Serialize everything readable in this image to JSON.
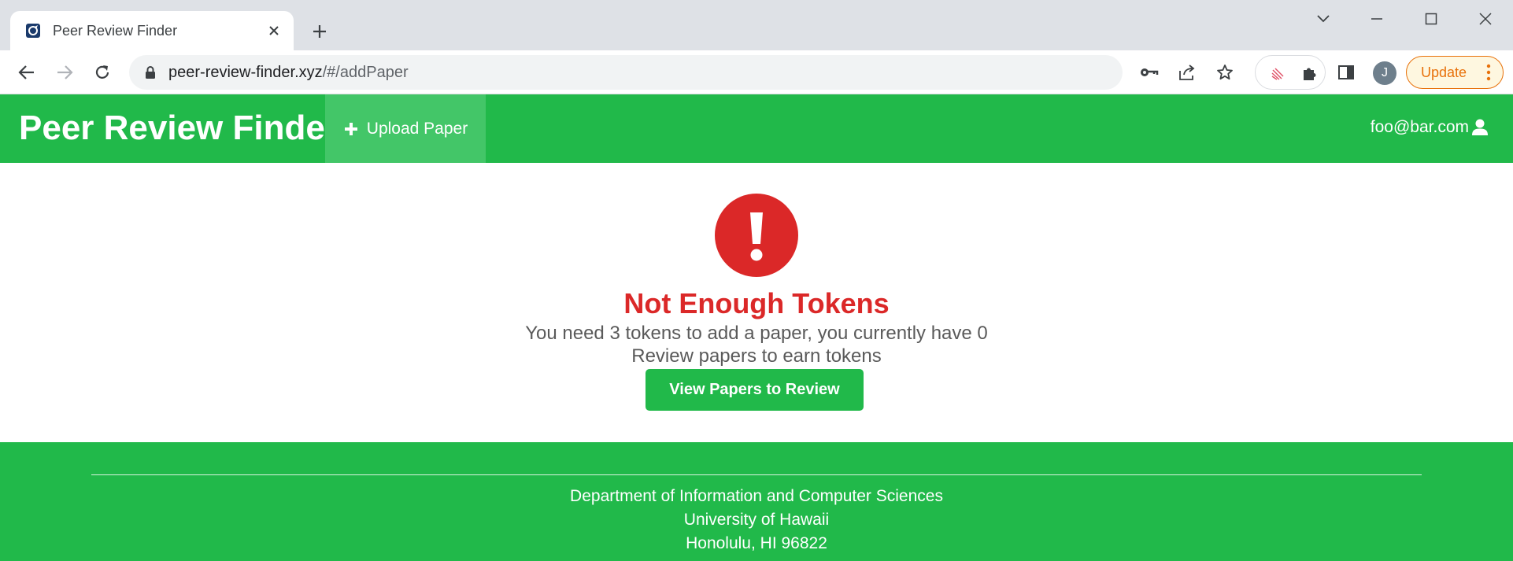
{
  "browser": {
    "tab_title": "Peer Review Finder",
    "url_host": "peer-review-finder.xyz",
    "url_path": "/#/addPaper",
    "profile_initial": "J",
    "update_label": "Update"
  },
  "navbar": {
    "brand": "Peer Review Finder",
    "upload_label": "Upload Paper",
    "user_email": "foo@bar.com"
  },
  "main": {
    "title": "Not Enough Tokens",
    "message_line1": "You need 3 tokens to add a paper, you currently have 0",
    "message_line2": "Review papers to earn tokens",
    "button_label": "View Papers to Review"
  },
  "footer": {
    "line1": "Department of Information and Computer Sciences",
    "line2": "University of Hawaii",
    "line3": "Honolulu, HI 96822"
  },
  "colors": {
    "brand_green": "#21b94a",
    "active_nav_green": "#43c668",
    "error_red": "#db2828",
    "update_orange": "#e8710a"
  },
  "icons": {
    "tab_favicon": "site-favicon-icon",
    "alert": "exclamation-circle-icon",
    "upload": "plus-icon",
    "user": "user-icon"
  }
}
